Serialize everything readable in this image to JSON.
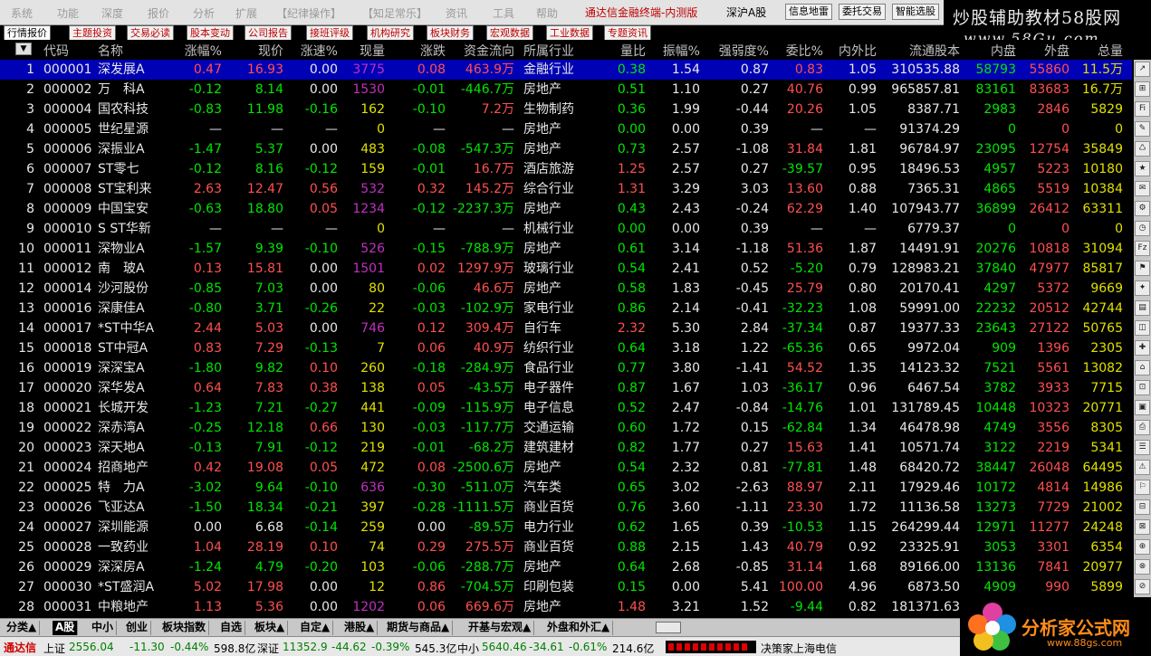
{
  "menu": [
    "系统",
    "功能",
    "深度",
    "报价",
    "分析",
    "扩展",
    "【纪律操作】",
    "【知足常乐】",
    "资讯",
    "工具",
    "帮助"
  ],
  "app_title": "通达信金融终端-内测版",
  "market_label": "深沪A股",
  "menu_buttons": [
    "信息地雷",
    "委托交易",
    "智能选股"
  ],
  "watermark": {
    "title": "炒股辅助教材58股网",
    "url": "www.58Gu.com"
  },
  "tabs": [
    "行情报价",
    "主题投资",
    "交易必读",
    "股本变动",
    "公司报告",
    "接班评级",
    "机构研究",
    "板块财务",
    "宏观数据",
    "工业数据",
    "专题资讯"
  ],
  "columns": [
    "代码",
    "名称",
    "涨幅%",
    "现价",
    "涨速%",
    "现量",
    "涨跌",
    "资金流向",
    "所属行业",
    "量比",
    "振幅%",
    "强弱度%",
    "委比%",
    "内外比",
    "流通股本",
    "内盘",
    "外盘",
    "总量"
  ],
  "rows": [
    [
      "1",
      "000001",
      "深发展A",
      "0.47",
      "16.93",
      "0.00",
      "3775",
      "0.08",
      "463.9万",
      "金融行业",
      "0.38",
      "1.54",
      "0.87",
      "0.83",
      "1.05",
      "310535.88",
      "58793",
      "55860",
      "11.5万"
    ],
    [
      "2",
      "000002",
      "万　科A",
      "-0.12",
      "8.14",
      "0.00",
      "1530",
      "-0.01",
      "-446.7万",
      "房地产",
      "0.51",
      "1.10",
      "0.27",
      "40.76",
      "0.99",
      "965857.81",
      "83161",
      "83683",
      "16.7万"
    ],
    [
      "3",
      "000004",
      "国农科技",
      "-0.83",
      "11.98",
      "-0.16",
      "162",
      "-0.10",
      "7.2万",
      "生物制药",
      "0.36",
      "1.99",
      "-0.44",
      "20.26",
      "1.05",
      "8387.71",
      "2983",
      "2846",
      "5829"
    ],
    [
      "4",
      "000005",
      "世纪星源",
      "—",
      "—",
      "—",
      "0",
      "—",
      "—",
      "房地产",
      "0.00",
      "0.00",
      "0.39",
      "—",
      "—",
      "91374.29",
      "0",
      "0",
      "0"
    ],
    [
      "5",
      "000006",
      "深振业A",
      "-1.47",
      "5.37",
      "0.00",
      "483",
      "-0.08",
      "-547.3万",
      "房地产",
      "0.73",
      "2.57",
      "-1.08",
      "31.84",
      "1.81",
      "96784.97",
      "23095",
      "12754",
      "35849"
    ],
    [
      "6",
      "000007",
      "ST零七",
      "-0.12",
      "8.16",
      "-0.12",
      "159",
      "-0.01",
      "16.7万",
      "酒店旅游",
      "1.25",
      "2.57",
      "0.27",
      "-39.57",
      "0.95",
      "18496.53",
      "4957",
      "5223",
      "10180"
    ],
    [
      "7",
      "000008",
      "ST宝利来",
      "2.63",
      "12.47",
      "0.56",
      "532",
      "0.32",
      "145.2万",
      "综合行业",
      "1.31",
      "3.29",
      "3.03",
      "13.60",
      "0.88",
      "7365.31",
      "4865",
      "5519",
      "10384"
    ],
    [
      "8",
      "000009",
      "中国宝安",
      "-0.63",
      "18.80",
      "0.05",
      "1234",
      "-0.12",
      "-2237.3万",
      "房地产",
      "0.43",
      "2.43",
      "-0.24",
      "62.29",
      "1.40",
      "107943.77",
      "36899",
      "26412",
      "63311"
    ],
    [
      "9",
      "000010",
      "S ST华新",
      "—",
      "—",
      "—",
      "0",
      "—",
      "—",
      "机械行业",
      "0.00",
      "0.00",
      "0.39",
      "—",
      "—",
      "6779.37",
      "0",
      "0",
      "0"
    ],
    [
      "10",
      "000011",
      "深物业A",
      "-1.57",
      "9.39",
      "-0.10",
      "526",
      "-0.15",
      "-788.9万",
      "房地产",
      "0.61",
      "3.14",
      "-1.18",
      "51.36",
      "1.87",
      "14491.91",
      "20276",
      "10818",
      "31094"
    ],
    [
      "11",
      "000012",
      "南　玻A",
      "0.13",
      "15.81",
      "0.00",
      "1501",
      "0.02",
      "1297.9万",
      "玻璃行业",
      "0.54",
      "2.41",
      "0.52",
      "-5.20",
      "0.79",
      "128983.21",
      "37840",
      "47977",
      "85817"
    ],
    [
      "12",
      "000014",
      "沙河股份",
      "-0.85",
      "7.03",
      "0.00",
      "80",
      "-0.06",
      "46.6万",
      "房地产",
      "0.58",
      "1.83",
      "-0.45",
      "25.79",
      "0.80",
      "20170.41",
      "4297",
      "5372",
      "9669"
    ],
    [
      "13",
      "000016",
      "深康佳A",
      "-0.80",
      "3.71",
      "-0.26",
      "22",
      "-0.03",
      "-102.9万",
      "家电行业",
      "0.86",
      "2.14",
      "-0.41",
      "-32.23",
      "1.08",
      "59991.00",
      "22232",
      "20512",
      "42744"
    ],
    [
      "14",
      "000017",
      "*ST中华A",
      "2.44",
      "5.03",
      "0.00",
      "746",
      "0.12",
      "309.4万",
      "自行车",
      "2.32",
      "5.30",
      "2.84",
      "-37.34",
      "0.87",
      "19377.33",
      "23643",
      "27122",
      "50765"
    ],
    [
      "15",
      "000018",
      "ST中冠A",
      "0.83",
      "7.29",
      "-0.13",
      "7",
      "0.06",
      "40.9万",
      "纺织行业",
      "0.64",
      "3.18",
      "1.22",
      "-65.36",
      "0.65",
      "9972.04",
      "909",
      "1396",
      "2305"
    ],
    [
      "16",
      "000019",
      "深深宝A",
      "-1.80",
      "9.82",
      "0.10",
      "260",
      "-0.18",
      "-284.9万",
      "食品行业",
      "0.77",
      "3.80",
      "-1.41",
      "54.52",
      "1.35",
      "14123.32",
      "7521",
      "5561",
      "13082"
    ],
    [
      "17",
      "000020",
      "深华发A",
      "0.64",
      "7.83",
      "0.38",
      "138",
      "0.05",
      "-43.5万",
      "电子器件",
      "0.87",
      "1.67",
      "1.03",
      "-36.17",
      "0.96",
      "6467.54",
      "3782",
      "3933",
      "7715"
    ],
    [
      "18",
      "000021",
      "长城开发",
      "-1.23",
      "7.21",
      "-0.27",
      "441",
      "-0.09",
      "-115.9万",
      "电子信息",
      "0.52",
      "2.47",
      "-0.84",
      "-14.76",
      "1.01",
      "131789.45",
      "10448",
      "10323",
      "20771"
    ],
    [
      "19",
      "000022",
      "深赤湾A",
      "-0.25",
      "12.18",
      "0.66",
      "130",
      "-0.03",
      "-117.7万",
      "交通运输",
      "0.60",
      "1.72",
      "0.15",
      "-62.84",
      "1.34",
      "46478.98",
      "4749",
      "3556",
      "8305"
    ],
    [
      "20",
      "000023",
      "深天地A",
      "-0.13",
      "7.91",
      "-0.12",
      "219",
      "-0.01",
      "-68.2万",
      "建筑建材",
      "0.82",
      "1.77",
      "0.27",
      "15.63",
      "1.41",
      "10571.74",
      "3122",
      "2219",
      "5341"
    ],
    [
      "21",
      "000024",
      "招商地产",
      "0.42",
      "19.08",
      "0.05",
      "472",
      "0.08",
      "-2500.6万",
      "房地产",
      "0.54",
      "2.32",
      "0.81",
      "-77.81",
      "1.48",
      "68420.72",
      "38447",
      "26048",
      "64495"
    ],
    [
      "22",
      "000025",
      "特　力A",
      "-3.02",
      "9.64",
      "-0.10",
      "636",
      "-0.30",
      "-511.0万",
      "汽车类",
      "0.65",
      "3.02",
      "-2.63",
      "88.97",
      "2.11",
      "17929.46",
      "10172",
      "4814",
      "14986"
    ],
    [
      "23",
      "000026",
      "飞亚达A",
      "-1.50",
      "18.34",
      "-0.21",
      "397",
      "-0.28",
      "-1111.5万",
      "商业百货",
      "0.76",
      "3.60",
      "-1.11",
      "23.30",
      "1.72",
      "11136.58",
      "13273",
      "7729",
      "21002"
    ],
    [
      "24",
      "000027",
      "深圳能源",
      "0.00",
      "6.68",
      "-0.14",
      "259",
      "0.00",
      "-89.5万",
      "电力行业",
      "0.62",
      "1.65",
      "0.39",
      "-10.53",
      "1.15",
      "264299.44",
      "12971",
      "11277",
      "24248"
    ],
    [
      "25",
      "000028",
      "一致药业",
      "1.04",
      "28.19",
      "0.10",
      "74",
      "0.29",
      "275.5万",
      "商业百货",
      "0.88",
      "2.15",
      "1.43",
      "40.79",
      "0.92",
      "23325.91",
      "3053",
      "3301",
      "6354"
    ],
    [
      "26",
      "000029",
      "深深房A",
      "-1.24",
      "4.79",
      "-0.20",
      "103",
      "-0.06",
      "-288.7万",
      "房地产",
      "0.64",
      "2.68",
      "-0.85",
      "31.14",
      "1.68",
      "89166.00",
      "13136",
      "7841",
      "20977"
    ],
    [
      "27",
      "000030",
      "*ST盛润A",
      "5.02",
      "17.98",
      "0.00",
      "12",
      "0.86",
      "-704.5万",
      "印刷包装",
      "0.15",
      "0.00",
      "5.41",
      "100.00",
      "4.96",
      "6873.50",
      "4909",
      "990",
      "5899"
    ],
    [
      "28",
      "000031",
      "中粮地产",
      "1.13",
      "5.36",
      "0.00",
      "1202",
      "0.06",
      "669.6万",
      "房地产",
      "1.48",
      "3.21",
      "1.52",
      "-9.44",
      "0.82",
      "181371.63",
      "",
      "",
      ""
    ]
  ],
  "right_icons": [
    "↗",
    "⊞",
    "Fi",
    "✎",
    "♺",
    "★",
    "✉",
    "⚙",
    "◷",
    "Fz",
    "⚑",
    "✦",
    "▤",
    "◫",
    "✚",
    "⌂",
    "⊡",
    "▣",
    "⎙",
    "☰",
    "⚠",
    "⚐",
    "⊟",
    "⊠",
    "⊕",
    "⊗",
    "⊘"
  ],
  "bottom_tabs": [
    "分类▲",
    "A股",
    "中小",
    "创业",
    "板块指数",
    "自选",
    "板块▲",
    "自定▲",
    "港股▲",
    "期货与商品▲",
    "开基与宏观▲",
    "外盘和外汇▲"
  ],
  "status": {
    "logo": "通达信",
    "sh_label": "上证",
    "sh_val": "2556.04",
    "sh_chg": "-11.30",
    "sh_pct": "-0.44%",
    "sh_amt": "598.8亿",
    "sz_label": "深证",
    "sz_val": "11352.9",
    "sz_chg": "-44.62",
    "sz_pct": "-0.39%",
    "sz_amt": "545.3亿",
    "zx_label": "中小",
    "zx_val": "5640.46",
    "zx_chg": "-34.61",
    "zx_pct": "-0.61%",
    "zx_amt": "214.6亿",
    "broker": "决策家上海电信"
  },
  "watermark_bottom": {
    "title": "分析家公式网",
    "url": "www.88gs.com"
  },
  "colors": {
    "up": "#ff5050",
    "down": "#00e600",
    "selected": "#0000b4",
    "volume": "#e0e000",
    "volume_alt": "#c030c0"
  }
}
